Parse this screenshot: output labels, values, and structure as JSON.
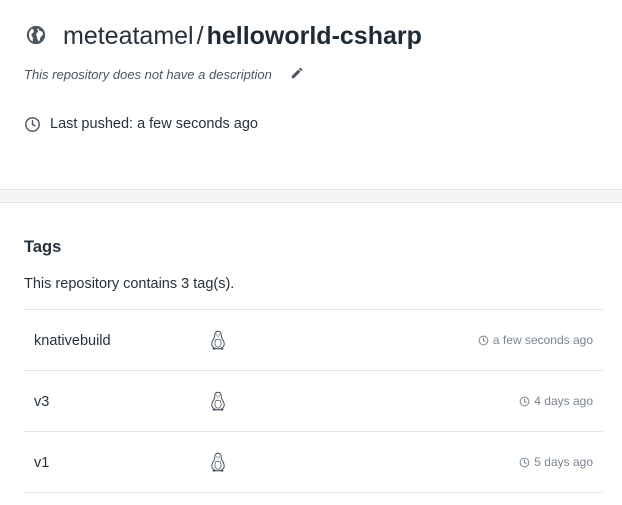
{
  "repository": {
    "namespace": "meteatamel",
    "separator": "/",
    "name": "helloworld-csharp",
    "description": "This repository does not have a description",
    "last_pushed": "Last pushed: a few seconds ago"
  },
  "icons": {
    "visibility": "globe-icon",
    "edit": "pencil-icon",
    "time": "clock-icon",
    "os": "linux-penguin-icon"
  },
  "tags": {
    "title": "Tags",
    "count_text": "This repository contains 3 tag(s).",
    "rows": [
      {
        "name": "knativebuild",
        "time": "a few seconds ago"
      },
      {
        "name": "v3",
        "time": "4 days ago"
      },
      {
        "name": "v1",
        "time": "5 days ago"
      }
    ]
  },
  "colors": {
    "text": "#27313b",
    "muted": "#7a8591",
    "border": "#dfe3e8",
    "band": "#f4f5f7"
  }
}
